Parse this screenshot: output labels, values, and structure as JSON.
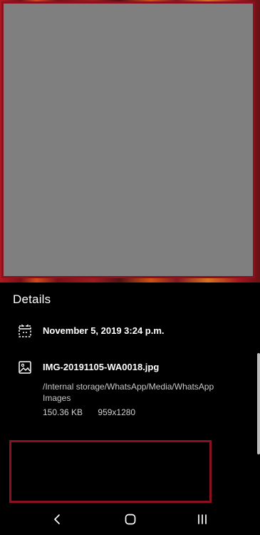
{
  "details": {
    "title": "Details",
    "date_taken": "November 5, 2019 3:24 p.m.",
    "file_name": "IMG-20191105-WA0018.jpg",
    "path": "/Internal storage/WhatsApp/Media/WhatsApp Images",
    "file_size": "150.36 KB",
    "resolution": "959x1280"
  },
  "icons": {
    "date": "calendar-icon",
    "file": "image-icon",
    "back": "back-icon",
    "home": "home-icon",
    "recents": "recents-icon"
  },
  "colors": {
    "background": "#000000",
    "redaction_fill": "#7f7f7f",
    "redaction_border": "#8b1020",
    "primary_text": "#ffffff",
    "secondary_text": "#c8c8c8"
  }
}
